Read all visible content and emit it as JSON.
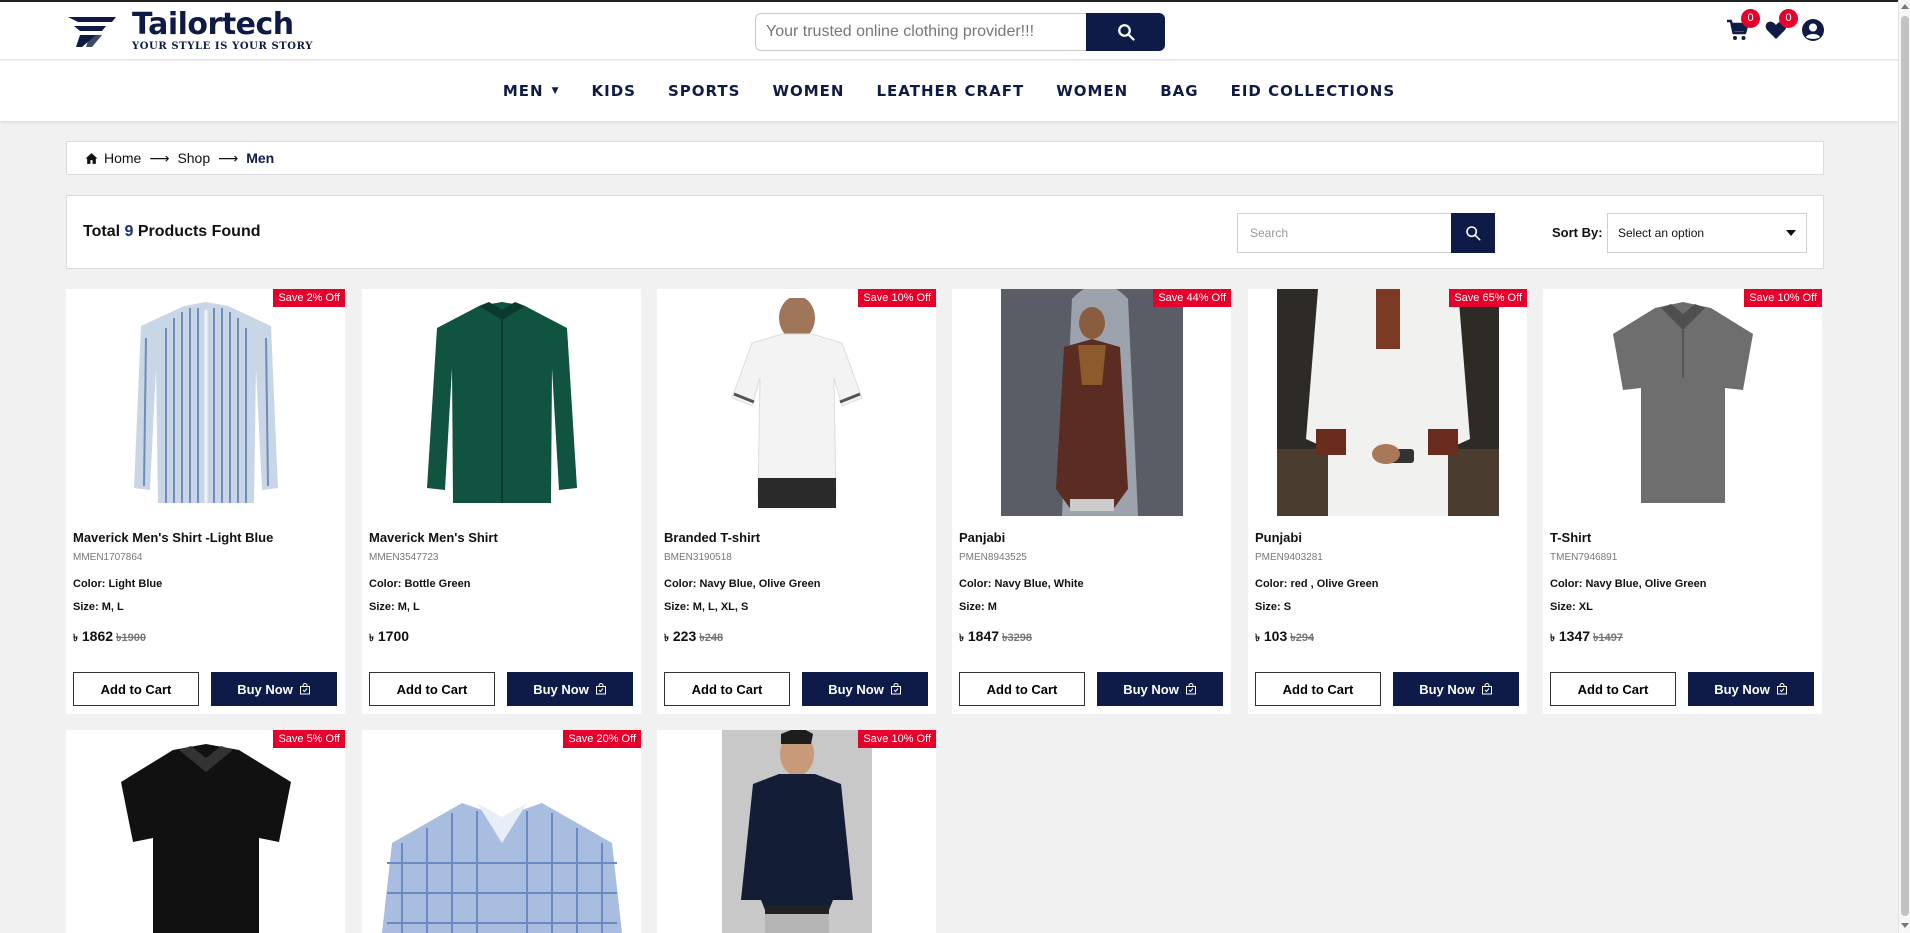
{
  "header": {
    "logo_name": "Tailortech",
    "logo_tagline": "YOUR STYLE IS YOUR STORY",
    "search_placeholder": "Your trusted online clothing provider!!!",
    "cart_count": "0",
    "wishlist_count": "0",
    "icons": [
      "search-icon",
      "cart-icon",
      "heart-icon",
      "user-icon"
    ]
  },
  "nav": {
    "items": [
      "MEN",
      "KIDS",
      "SPORTS",
      "WOMEN",
      "LEATHER CRAFT",
      "WOMEN",
      "BAG",
      "EID COLLECTIONS"
    ]
  },
  "breadcrumb": {
    "home": "Home",
    "shop": "Shop",
    "current": "Men"
  },
  "toolbar": {
    "total_prefix": "Total",
    "total_count": "9",
    "total_suffix": "Products Found",
    "search_placeholder": "Search",
    "sort_label": "Sort By:",
    "sort_value": "Select an option"
  },
  "currency": "৳",
  "buttons": {
    "add_to_cart": "Add to Cart",
    "buy_now": "Buy Now"
  },
  "products": [
    {
      "name": "Maverick Men's Shirt -Light Blue",
      "code": "MMEN1707864",
      "color": "Color: Light Blue",
      "size": "Size: M, L",
      "price": "1862",
      "old_price": "1900",
      "save": "Save 2% Off"
    },
    {
      "name": "Maverick Men's Shirt",
      "code": "MMEN3547723",
      "color": "Color: Bottle Green",
      "size": "Size: M, L",
      "price": "1700",
      "old_price": "",
      "save": ""
    },
    {
      "name": "Branded T-shirt",
      "code": "BMEN3190518",
      "color": "Color: Navy Blue, Olive Green",
      "size": "Size: M, L, XL, S",
      "price": "223",
      "old_price": "248",
      "save": "Save 10% Off"
    },
    {
      "name": "Panjabi",
      "code": "PMEN8943525",
      "color": "Color: Navy Blue, White",
      "size": "Size: M",
      "price": "1847",
      "old_price": "3298",
      "save": "Save 44% Off"
    },
    {
      "name": "Punjabi",
      "code": "PMEN9403281",
      "color": "Color: red , Olive Green",
      "size": "Size: S",
      "price": "103",
      "old_price": "294",
      "save": "Save 65% Off"
    },
    {
      "name": "T-Shirt",
      "code": "TMEN7946891",
      "color": "Color: Navy Blue, Olive Green",
      "size": "Size: XL",
      "price": "1347",
      "old_price": "1497",
      "save": "Save 10% Off"
    },
    {
      "save": "Save 5% Off"
    },
    {
      "save": "Save 20% Off"
    },
    {
      "save": "Save 10% Off"
    }
  ],
  "colors": {
    "navy": "#0e1a47",
    "sale_red": "#e4002b",
    "page_bg": "#f1f1f1"
  }
}
